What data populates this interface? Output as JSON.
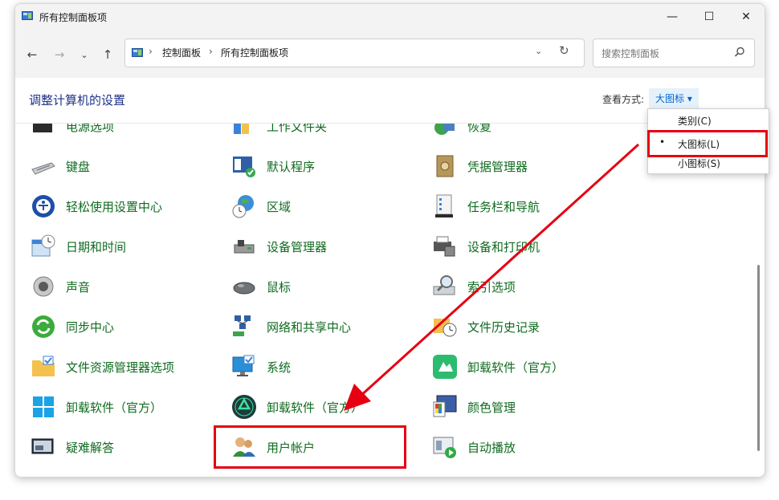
{
  "window": {
    "title": "所有控制面板项",
    "controls": {
      "minimize": "—",
      "maximize": "☐",
      "close": "✕"
    }
  },
  "nav": {
    "back": "←",
    "forward": "→",
    "recent": "⌄",
    "up": "↑"
  },
  "address": {
    "separator": "›",
    "crumbs": [
      "控制面板",
      "所有控制面板项"
    ],
    "dropdown": "⌄",
    "refresh": "↻"
  },
  "search": {
    "placeholder": "搜索控制面板"
  },
  "header": {
    "title": "调整计算机的设置",
    "view_by_label": "查看方式:",
    "view_by_value": "大图标 ▾"
  },
  "view_menu": {
    "items": [
      {
        "label": "类别(C)",
        "selected": false
      },
      {
        "label": "大图标(L)",
        "selected": true
      },
      {
        "label": "小图标(S)",
        "selected": false
      }
    ],
    "bullet": "•"
  },
  "items": [
    {
      "label": "电源选项",
      "icon": "power-options-icon"
    },
    {
      "label": "工作文件夹",
      "icon": "work-folders-icon"
    },
    {
      "label": "恢复",
      "icon": "recovery-icon"
    },
    {
      "label": "键盘",
      "icon": "keyboard-icon"
    },
    {
      "label": "默认程序",
      "icon": "default-programs-icon"
    },
    {
      "label": "凭据管理器",
      "icon": "credential-manager-icon"
    },
    {
      "label": "轻松使用设置中心",
      "icon": "ease-of-access-icon"
    },
    {
      "label": "区域",
      "icon": "region-icon"
    },
    {
      "label": "任务栏和导航",
      "icon": "taskbar-navigation-icon"
    },
    {
      "label": "日期和时间",
      "icon": "date-time-icon"
    },
    {
      "label": "设备管理器",
      "icon": "device-manager-icon"
    },
    {
      "label": "设备和打印机",
      "icon": "devices-printers-icon"
    },
    {
      "label": "声音",
      "icon": "sound-icon"
    },
    {
      "label": "鼠标",
      "icon": "mouse-icon"
    },
    {
      "label": "索引选项",
      "icon": "indexing-options-icon"
    },
    {
      "label": "同步中心",
      "icon": "sync-center-icon"
    },
    {
      "label": "网络和共享中心",
      "icon": "network-sharing-icon"
    },
    {
      "label": "文件历史记录",
      "icon": "file-history-icon"
    },
    {
      "label": "文件资源管理器选项",
      "icon": "explorer-options-icon"
    },
    {
      "label": "系统",
      "icon": "system-icon"
    },
    {
      "label": "卸载软件（官方）",
      "icon": "uninstall-green-icon"
    },
    {
      "label": "卸载软件（官方）",
      "icon": "windows-logo-icon"
    },
    {
      "label": "卸载软件（官方）",
      "icon": "recycle-icon"
    },
    {
      "label": "颜色管理",
      "icon": "color-management-icon"
    },
    {
      "label": "疑难解答",
      "icon": "troubleshooting-icon"
    },
    {
      "label": "用户帐户",
      "icon": "user-accounts-icon"
    },
    {
      "label": "自动播放",
      "icon": "autoplay-icon"
    }
  ],
  "colors": {
    "item_label": "#0f6b1f",
    "title_blue": "#1e3287",
    "highlight_red": "#e60012"
  }
}
